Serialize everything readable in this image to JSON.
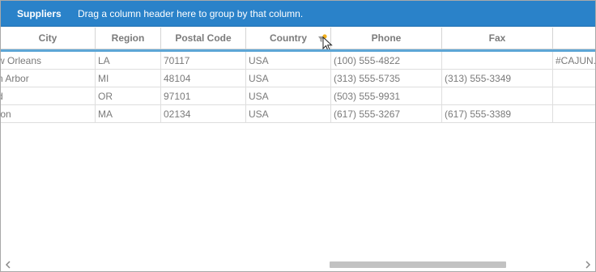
{
  "group_panel": {
    "title": "Suppliers",
    "hint": "Drag a column header here to group by that column."
  },
  "columns": [
    {
      "label": "City"
    },
    {
      "label": "Region"
    },
    {
      "label": "Postal Code"
    },
    {
      "label": "Country"
    },
    {
      "label": "Phone"
    },
    {
      "label": "Fax"
    },
    {
      "label": ""
    }
  ],
  "rows": [
    {
      "city": "w Orleans",
      "region": "LA",
      "postal": "70117",
      "country": "USA",
      "phone": "(100) 555-4822",
      "fax": "",
      "homepage": "#CAJUN.H"
    },
    {
      "city": "n Arbor",
      "region": "MI",
      "postal": "48104",
      "country": "USA",
      "phone": "(313) 555-5735",
      "fax": "(313) 555-3349",
      "homepage": ""
    },
    {
      "city": "d",
      "region": "OR",
      "postal": "97101",
      "country": "USA",
      "phone": "(503) 555-9931",
      "fax": "",
      "homepage": ""
    },
    {
      "city": "ton",
      "region": "MA",
      "postal": "02134",
      "country": "USA",
      "phone": "(617) 555-3267",
      "fax": "(617) 555-3389",
      "homepage": ""
    }
  ],
  "icons": {
    "filter": "filter-icon",
    "cursor": "mouse-pointer-icon",
    "scroll_left": "chevron-left-icon",
    "scroll_right": "chevron-right-icon"
  },
  "colors": {
    "header_bar": "#2a82c9",
    "header_accent": "#5da6d6",
    "filter_badge": "#f2b01e"
  }
}
